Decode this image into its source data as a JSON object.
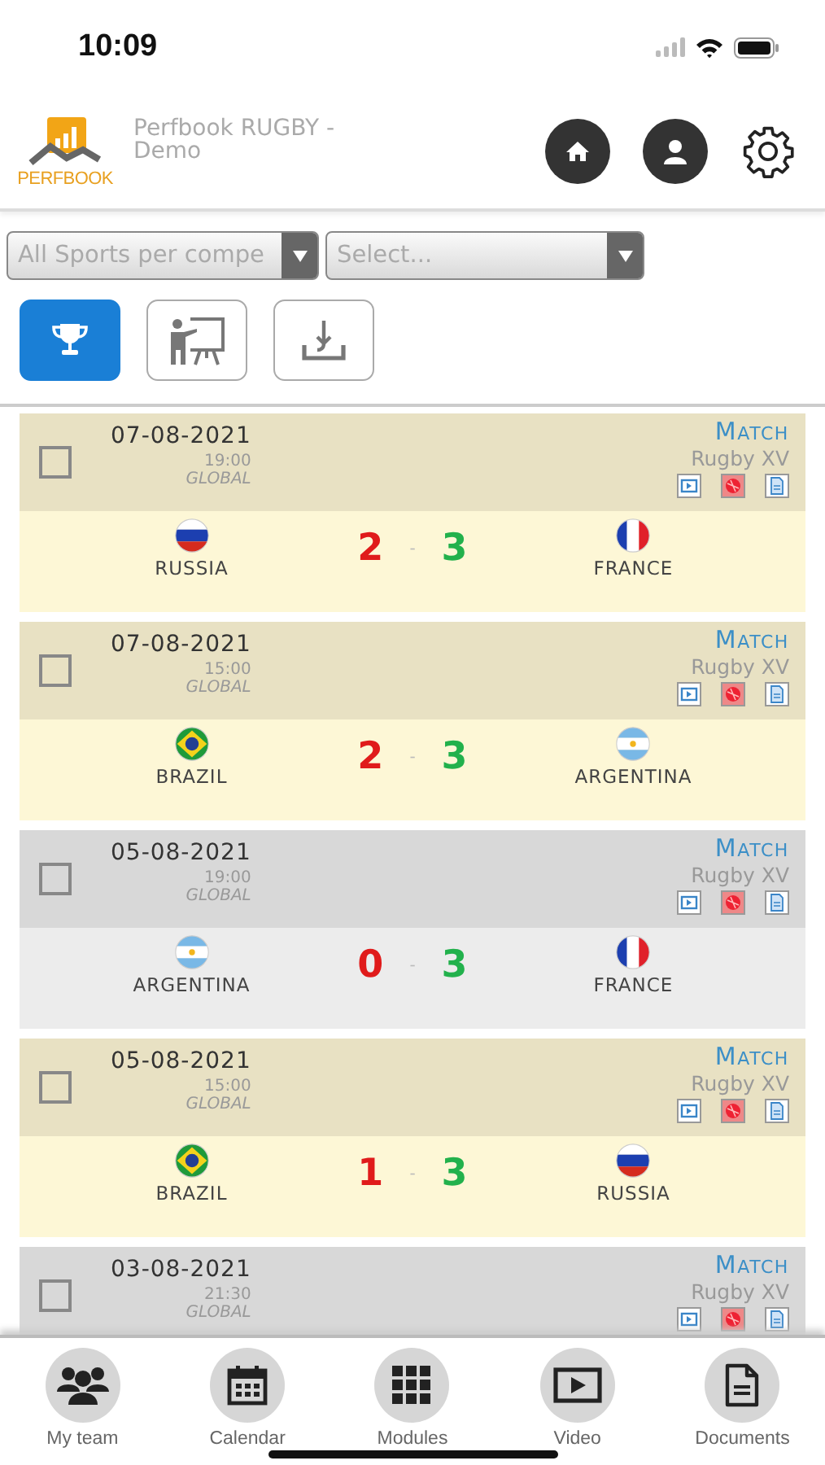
{
  "status_bar": {
    "time": "10:09"
  },
  "header": {
    "app_title": "Perfbook RUGBY - Demo",
    "logo_text": "PERFBOOK"
  },
  "filters": [
    {
      "value": "All Sports per compe"
    },
    {
      "placeholder": "Select..."
    }
  ],
  "view_tabs": [
    {
      "kind": "trophy",
      "selected": true
    },
    {
      "kind": "presentation",
      "selected": false
    },
    {
      "kind": "download",
      "selected": false
    }
  ],
  "matches": [
    {
      "kind": "featured",
      "checked": false,
      "date": "07-08-2021",
      "time": "19:00",
      "scope": "GLOBAL",
      "type": "Match",
      "sport": "Rugby XV",
      "home": {
        "name": "RUSSIA",
        "kind": "ru"
      },
      "away": {
        "name": "FRANCE",
        "kind": "fr"
      },
      "home_score": {
        "value": "2",
        "kind": "loss"
      },
      "away_score": {
        "value": "3",
        "kind": "win"
      },
      "separator": "-"
    },
    {
      "kind": "featured",
      "checked": false,
      "date": "07-08-2021",
      "time": "15:00",
      "scope": "GLOBAL",
      "type": "Match",
      "sport": "Rugby XV",
      "home": {
        "name": "BRAZIL",
        "kind": "br"
      },
      "away": {
        "name": "ARGENTINA",
        "kind": "ar"
      },
      "home_score": {
        "value": "2",
        "kind": "loss"
      },
      "away_score": {
        "value": "3",
        "kind": "win"
      },
      "separator": "-"
    },
    {
      "kind": "standard",
      "checked": false,
      "date": "05-08-2021",
      "time": "19:00",
      "scope": "GLOBAL",
      "type": "Match",
      "sport": "Rugby XV",
      "home": {
        "name": "ARGENTINA",
        "kind": "ar"
      },
      "away": {
        "name": "FRANCE",
        "kind": "fr"
      },
      "home_score": {
        "value": "0",
        "kind": "loss"
      },
      "away_score": {
        "value": "3",
        "kind": "win"
      },
      "separator": "-"
    },
    {
      "kind": "featured",
      "checked": false,
      "date": "05-08-2021",
      "time": "15:00",
      "scope": "GLOBAL",
      "type": "Match",
      "sport": "Rugby XV",
      "home": {
        "name": "BRAZIL",
        "kind": "br"
      },
      "away": {
        "name": "RUSSIA",
        "kind": "ru"
      },
      "home_score": {
        "value": "1",
        "kind": "loss"
      },
      "away_score": {
        "value": "3",
        "kind": "win"
      },
      "separator": "-"
    },
    {
      "kind": "standard",
      "checked": false,
      "date": "03-08-2021",
      "time": "21:30",
      "scope": "GLOBAL",
      "type": "Match",
      "sport": "Rugby XV"
    }
  ],
  "tab_bar": [
    {
      "kind": "team",
      "label": "My team"
    },
    {
      "kind": "calendar",
      "label": "Calendar"
    },
    {
      "kind": "modules",
      "label": "Modules"
    },
    {
      "kind": "video",
      "label": "Video"
    },
    {
      "kind": "documents",
      "label": "Documents"
    }
  ]
}
